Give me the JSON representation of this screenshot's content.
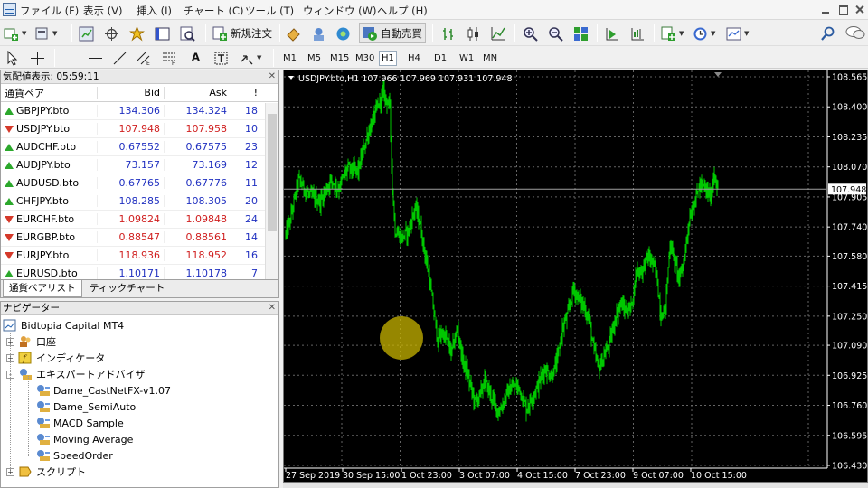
{
  "menu": [
    "ファイル (F)",
    "表示 (V)",
    "挿入 (I)",
    "チャート (C)",
    "ツール (T)",
    "ウィンドウ (W)",
    "ヘルプ (H)"
  ],
  "toolbar": {
    "new_order": "新規注文",
    "auto_trade": "自動売買"
  },
  "drawing_tools": {
    "text_tool": "A"
  },
  "timeframes": [
    "M1",
    "M5",
    "M15",
    "M30",
    "H1",
    "H4",
    "D1",
    "W1",
    "MN"
  ],
  "active_timeframe": "H1",
  "market_watch": {
    "title": "気配値表示: 05:59:11",
    "columns": [
      "通貨ペア",
      "Bid",
      "Ask",
      "!"
    ],
    "rows": [
      {
        "symbol": "GBPJPY.bto",
        "bid": "134.306",
        "ask": "134.324",
        "spread": "18",
        "dir": "up"
      },
      {
        "symbol": "USDJPY.bto",
        "bid": "107.948",
        "ask": "107.958",
        "spread": "10",
        "dir": "down"
      },
      {
        "symbol": "AUDCHF.bto",
        "bid": "0.67552",
        "ask": "0.67575",
        "spread": "23",
        "dir": "up"
      },
      {
        "symbol": "AUDJPY.bto",
        "bid": "73.157",
        "ask": "73.169",
        "spread": "12",
        "dir": "up"
      },
      {
        "symbol": "AUDUSD.bto",
        "bid": "0.67765",
        "ask": "0.67776",
        "spread": "11",
        "dir": "up"
      },
      {
        "symbol": "CHFJPY.bto",
        "bid": "108.285",
        "ask": "108.305",
        "spread": "20",
        "dir": "up"
      },
      {
        "symbol": "EURCHF.bto",
        "bid": "1.09824",
        "ask": "1.09848",
        "spread": "24",
        "dir": "down"
      },
      {
        "symbol": "EURGBP.bto",
        "bid": "0.88547",
        "ask": "0.88561",
        "spread": "14",
        "dir": "down"
      },
      {
        "symbol": "EURJPY.bto",
        "bid": "118.936",
        "ask": "118.952",
        "spread": "16",
        "dir": "down"
      },
      {
        "symbol": "EURUSD.bto",
        "bid": "1.10171",
        "ask": "1.10178",
        "spread": "7",
        "dir": "up"
      }
    ],
    "tabs": [
      "通貨ペアリスト",
      "ティックチャート"
    ]
  },
  "navigator": {
    "title": "ナビゲーター",
    "root": "Bidtopia Capital MT4",
    "items": [
      {
        "label": "口座",
        "level": 1,
        "icon": "accounts-icon"
      },
      {
        "label": "インディケータ",
        "level": 1,
        "icon": "indicators-icon"
      },
      {
        "label": "エキスパートアドバイザ",
        "level": 1,
        "icon": "expert-advisors-icon"
      },
      {
        "label": "Dame_CastNetFX-v1.07",
        "level": 2,
        "icon": "expert-icon"
      },
      {
        "label": "Dame_SemiAuto",
        "level": 2,
        "icon": "expert-icon"
      },
      {
        "label": "MACD Sample",
        "level": 2,
        "icon": "expert-icon"
      },
      {
        "label": "Moving Average",
        "level": 2,
        "icon": "expert-icon"
      },
      {
        "label": "SpeedOrder",
        "level": 2,
        "icon": "expert-icon"
      },
      {
        "label": "スクリプト",
        "level": 1,
        "icon": "scripts-icon"
      }
    ]
  },
  "chart": {
    "header": "USDJPY.bto,H1  107.966 107.969 107.931 107.948",
    "current_price": "107.948",
    "price_labels": [
      "108.565",
      "108.400",
      "108.235",
      "108.070",
      "107.905",
      "107.740",
      "107.580",
      "107.415",
      "107.250",
      "107.090",
      "106.925",
      "106.760",
      "106.595",
      "106.430"
    ],
    "time_labels": [
      "27 Sep 2019",
      "30 Sep 15:00",
      "1 Oct 23:00",
      "3 Oct 07:00",
      "4 Oct 15:00",
      "7 Oct 23:00",
      "9 Oct 07:00",
      "10 Oct 15:00"
    ]
  },
  "colors": {
    "chart_bg": "#000000",
    "bar_color": "#00c800",
    "grid_color": "#646464",
    "price_line": "#a0a0a0",
    "cursor_highlight": "#c8b400",
    "bid_color": "#2030c0",
    "ask_color": "#2030c0",
    "down_color": "#d02020"
  }
}
